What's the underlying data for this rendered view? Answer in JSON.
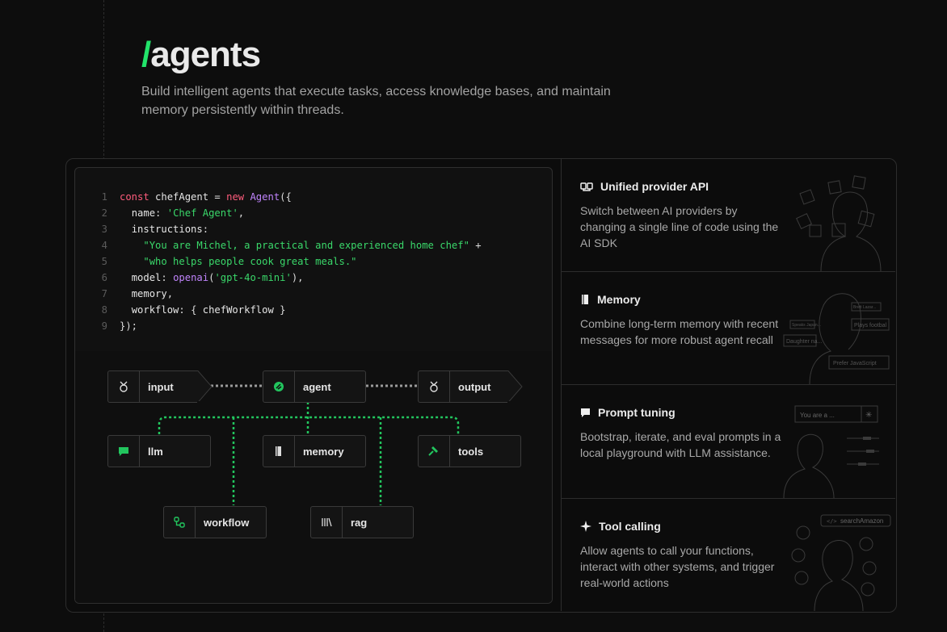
{
  "hero": {
    "slash": "/",
    "title": "agents",
    "subtitle": "Build intelligent agents that execute tasks, access knowledge bases, and maintain memory persistently within threads."
  },
  "code": {
    "lines": [
      [
        "1",
        "const chefAgent = new Agent({"
      ],
      [
        "2",
        "  name: 'Chef Agent',"
      ],
      [
        "3",
        "  instructions:"
      ],
      [
        "4",
        "    \"You are Michel, a practical and experienced home chef\" +"
      ],
      [
        "5",
        "    \"who helps people cook great meals.\""
      ],
      [
        "6",
        "  model: openai('gpt-4o-mini'),"
      ],
      [
        "7",
        "  memory,"
      ],
      [
        "8",
        "  workflow: { chefWorkflow }"
      ],
      [
        "9",
        "});"
      ]
    ]
  },
  "diagram": {
    "input": "input",
    "agent": "agent",
    "output": "output",
    "llm": "llm",
    "memory": "memory",
    "tools": "tools",
    "workflow": "workflow",
    "rag": "rag"
  },
  "features": [
    {
      "title": "Unified provider API",
      "desc": "Switch between AI providers by changing a single line of code using the AI SDK",
      "icon": "provider-icon"
    },
    {
      "title": "Memory",
      "desc": "Combine long-term memory with recent messages for more robust agent recall",
      "icon": "book-icon",
      "art_labels": [
        "Daughter na...",
        "Plays footbal",
        "Prefer JavaScript",
        "Speaks Japan...",
        "Brett Lazar..."
      ]
    },
    {
      "title": "Prompt tuning",
      "desc": "Bootstrap, iterate, and eval prompts in a local playground with LLM assistance.",
      "icon": "chat-icon",
      "art_labels": [
        "You are a ..."
      ]
    },
    {
      "title": "Tool calling",
      "desc": "Allow agents to call your functions, interact with other systems, and trigger real-world actions",
      "icon": "sparkle-icon",
      "art_labels": [
        "searchAmazon"
      ]
    }
  ],
  "colors": {
    "accent": "#22e36a",
    "keyword": "#ff5c7c",
    "function": "#c084fc",
    "string": "#3ad86a"
  }
}
